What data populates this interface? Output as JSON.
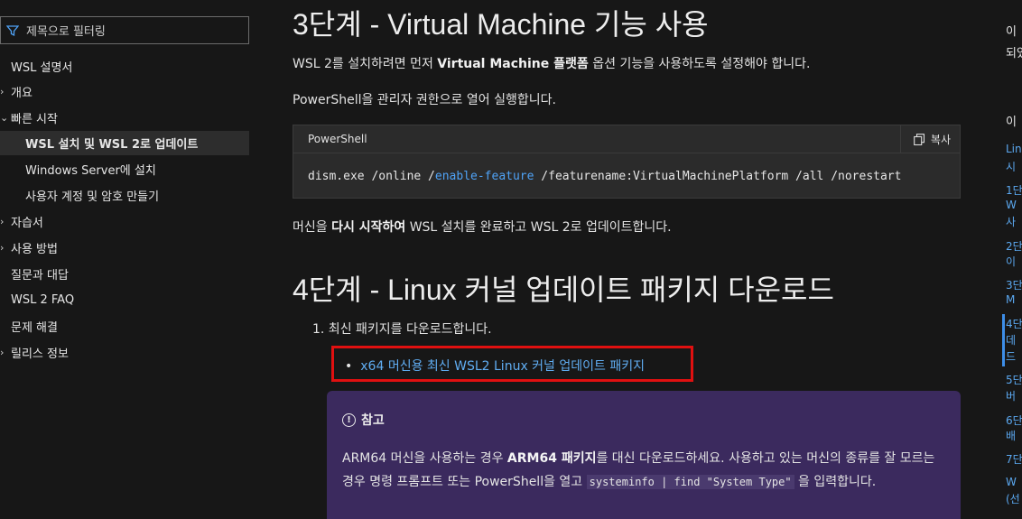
{
  "nav": {
    "filter_placeholder": "제목으로 필터링",
    "items": [
      {
        "label": "WSL 설명서",
        "chev": "",
        "indent": 0
      },
      {
        "label": "개요",
        "chev": "›",
        "indent": 0
      },
      {
        "label": "빠른 시작",
        "chev": "⌄",
        "indent": 0
      },
      {
        "label": "WSL 설치 및 WSL 2로 업데이트",
        "chev": "",
        "indent": 1,
        "selected": true
      },
      {
        "label": "Windows Server에 설치",
        "chev": "",
        "indent": 1
      },
      {
        "label": "사용자 계정 및 암호 만들기",
        "chev": "",
        "indent": 1
      },
      {
        "label": "자습서",
        "chev": "›",
        "indent": 0
      },
      {
        "label": "사용 방법",
        "chev": "›",
        "indent": 0
      },
      {
        "label": "질문과 대답",
        "chev": "",
        "indent": 0
      },
      {
        "label": "WSL 2 FAQ",
        "chev": "",
        "indent": 0
      },
      {
        "label": "문제 해결",
        "chev": "",
        "indent": 0
      },
      {
        "label": "릴리스 정보",
        "chev": "›",
        "indent": 0
      }
    ]
  },
  "main": {
    "step3_title": "3단계 - Virtual Machine 기능 사용",
    "step3_p1_a": "WSL 2를 설치하려면 먼저 ",
    "step3_p1_b": "Virtual Machine 플랫폼",
    "step3_p1_c": " 옵션 기능을 사용하도록 설정해야 합니다.",
    "step3_p2": "PowerShell을 관리자 권한으로 열어 실행합니다.",
    "code": {
      "lang": "PowerShell",
      "copy_label": "복사",
      "line_a": "dism.exe /online /",
      "line_kw": "enable-feature",
      "line_b": " /featurename:VirtualMachinePlatform /all /norestart"
    },
    "step3_p3_a": "머신을 ",
    "step3_p3_b": "다시 시작하여",
    "step3_p3_c": " WSL 설치를 완료하고 WSL 2로 업데이트합니다.",
    "step4_title": "4단계 - Linux 커널 업데이트 패키지 다운로드",
    "ol_item": "1. 최신 패키지를 다운로드합니다.",
    "download_link": "x64 머신용 최신 WSL2 Linux 커널 업데이트 패키지",
    "note": {
      "title": "참고",
      "p_a": "ARM64 머신을 사용하는 경우 ",
      "p_b": "ARM64 패키지",
      "p_c": "를 대신 다운로드하세요. 사용하고 있는 머신의 종류를 잘 모르는 경우 명령 프롬프트 또는 PowerShell을 열고 ",
      "p_code": "systeminfo | find \"System Type\"",
      "p_d": " 을 입력합니다."
    }
  },
  "toc": {
    "items": [
      "이",
      "되었",
      "",
      "이",
      "Lin",
      "시",
      "1단",
      "W",
      "사",
      "2단",
      "이",
      "3단",
      "M",
      "4단",
      "데",
      "드",
      "5단",
      "버",
      "6단",
      "배",
      "7단",
      "W",
      "(선"
    ]
  },
  "colors": {
    "background": "#171717",
    "link": "#60adf2",
    "highlight_border": "#e01010",
    "note_bg": "#3b2a5e",
    "code_keyword": "#4fa3f7"
  }
}
